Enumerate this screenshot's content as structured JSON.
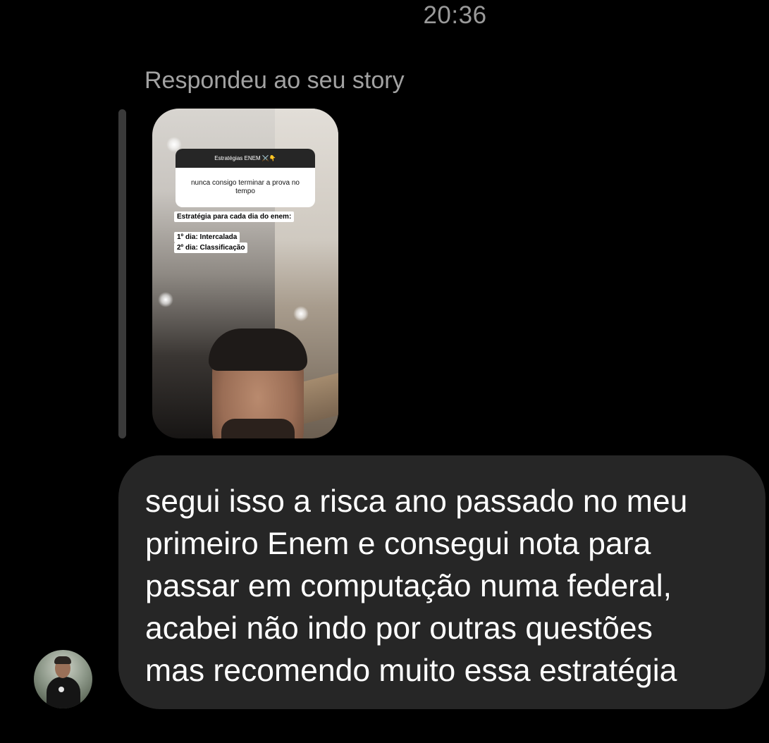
{
  "header": {
    "timestamp": "20:36"
  },
  "reply": {
    "label": "Respondeu ao seu story"
  },
  "story": {
    "question_title": "Estratégias ENEM ⚔️👇",
    "question_text": "nunca consigo terminar a prova no tempo",
    "tag_title": "Estratégia para cada dia do enem:",
    "tag_day1": "1º dia: Intercalada",
    "tag_day2": "2º dia: Classificação"
  },
  "message": {
    "text": "segui isso a risca ano passado no meu\nprimeiro Enem e consegui nota para\npassar em computação numa federal,\nacabei não indo por outras questões\nmas recomendo muito essa estratégia"
  },
  "colors": {
    "background": "#000000",
    "bubble": "#262626",
    "muted_text": "#a2a2a2",
    "reply_bar": "#3a3a3a"
  }
}
